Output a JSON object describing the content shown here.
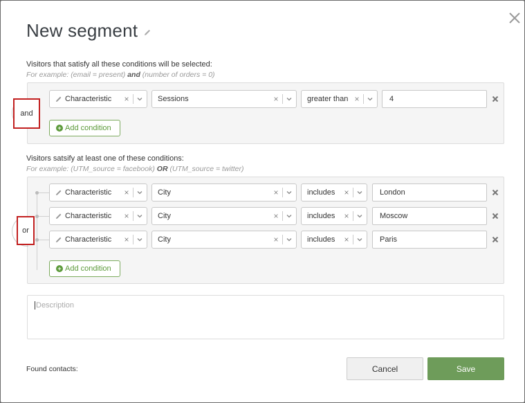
{
  "modal": {
    "title": "New segment",
    "close_icon": "close-icon",
    "edit_icon": "pencil-icon"
  },
  "all_group": {
    "intro": "Visitors that satisfy all these conditions will be selected:",
    "example_prefix": "For example: (email = present) ",
    "example_op": "and",
    "example_suffix": " (number of orders = 0)",
    "operator": "and",
    "conditions": [
      {
        "type": "Characteristic",
        "field": "Sessions",
        "operator": "greater than",
        "value": "4"
      }
    ],
    "add_label": "Add condition"
  },
  "any_group": {
    "intro": "Visitors satsify at least one of these conditions:",
    "example_prefix": "For example: (UTM_source = facebook) ",
    "example_op": "OR",
    "example_suffix": " (UTM_source = twitter)",
    "operator": "or",
    "conditions": [
      {
        "type": "Characteristic",
        "field": "City",
        "operator": "includes",
        "value": "London"
      },
      {
        "type": "Characteristic",
        "field": "City",
        "operator": "includes",
        "value": "Moscow"
      },
      {
        "type": "Characteristic",
        "field": "City",
        "operator": "includes",
        "value": "Paris"
      }
    ],
    "add_label": "Add condition"
  },
  "description": {
    "placeholder": "Description"
  },
  "footer": {
    "found_label": "Found contacts:",
    "cancel_label": "Cancel",
    "save_label": "Save"
  },
  "colors": {
    "save_bg": "#6e9c5a",
    "add_green": "#5c9a3a",
    "highlight_red": "#c21f1f"
  }
}
